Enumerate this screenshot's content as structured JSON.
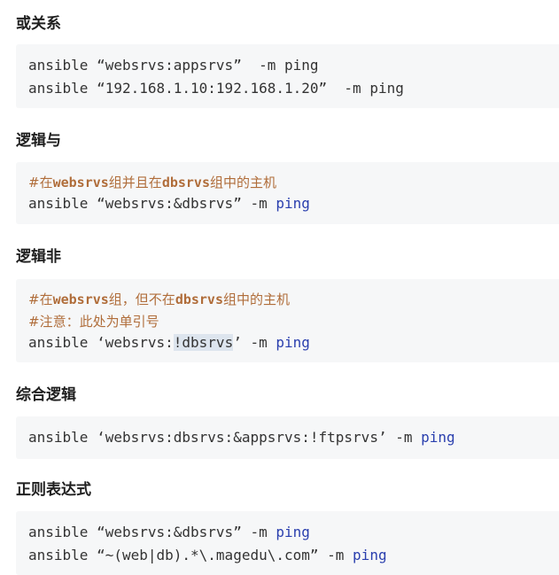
{
  "sections": [
    {
      "heading": "或关系",
      "lines": [
        {
          "plain": "ansible “websrvs:appsrvs”  -m ping"
        },
        {
          "plain": "ansible “192.168.1.10:192.168.1.20”  -m ping"
        }
      ]
    },
    {
      "heading": "逻辑与",
      "comment": {
        "hash": "#在",
        "a": "websrvs",
        "mid": "组并且在",
        "b": "dbsrvs",
        "end": "组中的主机"
      },
      "code": {
        "pre": "ansible “websrvs:&dbsrvs” -m ",
        "kw": "ping"
      }
    },
    {
      "heading": "逻辑非",
      "comment": {
        "hash": "#在",
        "a": "websrvs",
        "mid": "组，但不在",
        "b": "dbsrvs",
        "end": "组中的主机"
      },
      "note": "#注意：此处为单引号",
      "code": {
        "pre": "ansible ‘websrvs:",
        "hl": "!dbsrvs",
        "post": "’ -m ",
        "kw": "ping"
      }
    },
    {
      "heading": "综合逻辑",
      "code": {
        "pre": "ansible ‘websrvs:dbsrvs:&appsrvs:!ftpsrvs’ -m ",
        "kw": "ping"
      }
    },
    {
      "heading": "正则表达式",
      "code1": {
        "pre": "ansible “websrvs:&dbsrvs” -m ",
        "kw": "ping"
      },
      "code2": {
        "pre": "ansible “~(web|db).*\\.magedu\\.com” -m ",
        "kw": "ping"
      }
    }
  ]
}
